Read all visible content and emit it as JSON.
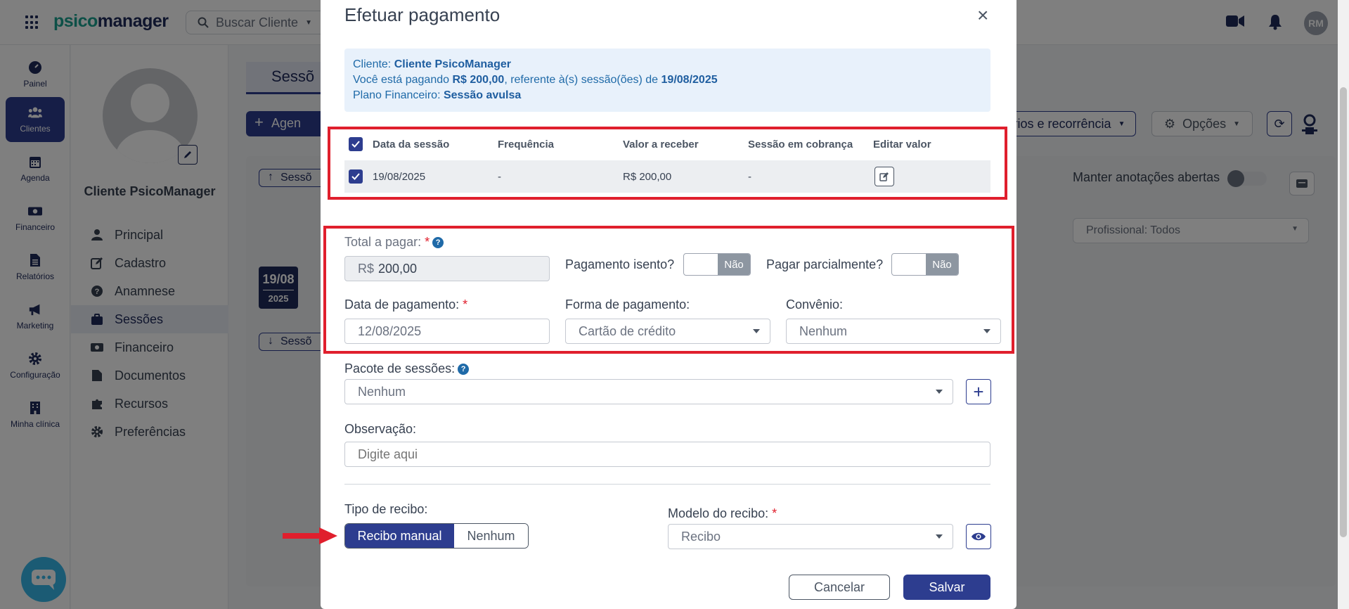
{
  "topbar": {
    "logo_prefix": "psico",
    "logo_suffix": "manager",
    "search_placeholder": "Buscar Cliente",
    "avatar_initials": "RM"
  },
  "leftnav": {
    "items": [
      {
        "label": "Painel",
        "icon": "gauge-icon"
      },
      {
        "label": "Clientes",
        "icon": "users-icon"
      },
      {
        "label": "Agenda",
        "icon": "calendar-icon"
      },
      {
        "label": "Financeiro",
        "icon": "money-icon"
      },
      {
        "label": "Relatórios",
        "icon": "report-icon"
      },
      {
        "label": "Marketing",
        "icon": "megaphone-icon"
      },
      {
        "label": "Configuração",
        "icon": "gear-icon"
      },
      {
        "label": "Minha clínica",
        "icon": "building-icon"
      }
    ],
    "active_index": 1
  },
  "client_panel": {
    "name": "Cliente PsicoManager",
    "menu": [
      {
        "label": "Principal"
      },
      {
        "label": "Cadastro"
      },
      {
        "label": "Anamnese"
      },
      {
        "label": "Sessões"
      },
      {
        "label": "Financeiro"
      },
      {
        "label": "Documentos"
      },
      {
        "label": "Recursos"
      },
      {
        "label": "Preferências"
      }
    ],
    "active_index": 3
  },
  "main": {
    "tab_label": "Sessõ",
    "add_button": "Agen",
    "pill_up": "Sessõ",
    "pill_down": "Sessõ",
    "date_chip": {
      "day": "19/08",
      "year": "2025"
    },
    "recorrencia_button": "rios e recorrência",
    "opcoes_button": "Opções",
    "manter_label": "Manter anotações abertas",
    "profissional_select": "Profissional: Todos"
  },
  "modal": {
    "title": "Efetuar pagamento",
    "close": "×",
    "info": {
      "cliente_label": "Cliente:",
      "cliente_value": "Cliente PsicoManager",
      "pagando_prefix": "Você está pagando",
      "pagando_value": "R$ 200,00",
      "pagando_mid": ", referente à(s) sessão(ões) de",
      "pagando_date": "19/08/2025",
      "plano_label": "Plano Financeiro:",
      "plano_value": "Sessão avulsa"
    },
    "table": {
      "headers": [
        "Data da sessão",
        "Frequência",
        "Valor a receber",
        "Sessão em cobrança",
        "Editar valor"
      ],
      "rows": [
        {
          "data": "19/08/2025",
          "frequencia": "-",
          "valor": "R$ 200,00",
          "cobranca": "-"
        }
      ]
    },
    "form": {
      "total_label": "Total a pagar:",
      "total_prefix": "R$",
      "total_value": "200,00",
      "isento_label": "Pagamento isento?",
      "isento_value": "Não",
      "parcial_label": "Pagar parcialmente?",
      "parcial_value": "Não",
      "data_label": "Data de pagamento:",
      "data_value": "12/08/2025",
      "forma_label": "Forma de pagamento:",
      "forma_value": "Cartão de crédito",
      "convenio_label": "Convênio:",
      "convenio_value": "Nenhum",
      "pacote_label": "Pacote de sessões:",
      "pacote_value": "Nenhum",
      "obs_label": "Observação:",
      "obs_placeholder": "Digite aqui",
      "tipo_recibo_label": "Tipo de recibo:",
      "tipo_recibo_options": [
        "Recibo manual",
        "Nenhum"
      ],
      "modelo_label": "Modelo do recibo:",
      "modelo_value": "Recibo"
    },
    "buttons": {
      "cancel": "Cancelar",
      "save": "Salvar"
    }
  },
  "colors": {
    "primary": "#2d3d8f",
    "highlight_red": "#e01f2d",
    "info_bg": "#e8f1fb",
    "chat_blue": "#36b6e8"
  }
}
